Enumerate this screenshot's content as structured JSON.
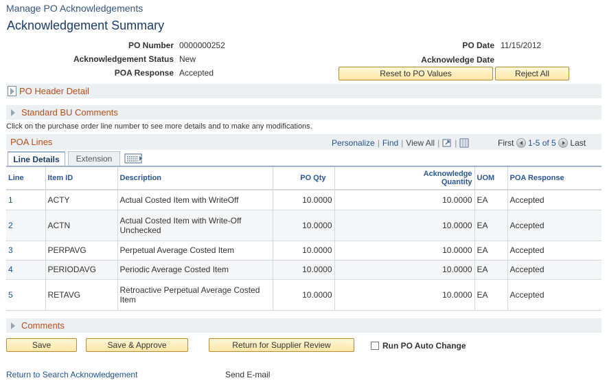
{
  "header": {
    "breadcrumb": "Manage PO Acknowledgements",
    "title": "Acknowledgement Summary"
  },
  "summary": {
    "po_number_label": "PO Number",
    "po_number": "0000000252",
    "ack_status_label": "Acknowledgement Status",
    "ack_status": "New",
    "poa_response_label": "POA Response",
    "poa_response": "Accepted",
    "po_date_label": "PO Date",
    "po_date": "11/15/2012",
    "ack_date_label": "Acknowledge Date",
    "reset_button": "Reset to PO Values",
    "reject_button": "Reject All"
  },
  "sections": {
    "po_header_detail": "PO Header Detail",
    "standard_bu_comments": "Standard BU Comments",
    "comments": "Comments"
  },
  "instruction": "Click on the purchase order line number to see more details and to make any modifications.",
  "grid": {
    "title": "POA Lines",
    "personalize": "Personalize",
    "find": "Find",
    "view_all": "View All",
    "first": "First",
    "range": "1-5 of 5",
    "last": "Last",
    "tabs": {
      "line_details": "Line Details",
      "extension": "Extension"
    },
    "columns": {
      "line": "Line",
      "item_id": "Item ID",
      "description": "Description",
      "po_qty": "PO Qty",
      "ack_qty_1": "Acknowledge",
      "ack_qty_2": "Quantity",
      "uom": "UOM",
      "poa_response": "POA Response"
    },
    "rows": [
      {
        "line": "1",
        "item_id": "ACTY",
        "description": "Actual Costed Item with WriteOff",
        "po_qty": "10.0000",
        "ack_qty": "10.0000",
        "uom": "EA",
        "response": "Accepted"
      },
      {
        "line": "2",
        "item_id": "ACTN",
        "description": "Actual Costed Item with Write-Off Unchecked",
        "po_qty": "10.0000",
        "ack_qty": "10.0000",
        "uom": "EA",
        "response": "Accepted"
      },
      {
        "line": "3",
        "item_id": "PERPAVG",
        "description": "Perpetual Average Costed Item",
        "po_qty": "10.0000",
        "ack_qty": "10.0000",
        "uom": "EA",
        "response": "Accepted"
      },
      {
        "line": "4",
        "item_id": "PERIODAVG",
        "description": "Periodic Average Costed Item",
        "po_qty": "10.0000",
        "ack_qty": "10.0000",
        "uom": "EA",
        "response": "Accepted"
      },
      {
        "line": "5",
        "item_id": "RETAVG",
        "description": "Retroactive Perpetual Average Costed Item",
        "po_qty": "10.0000",
        "ack_qty": "10.0000",
        "uom": "EA",
        "response": "Accepted"
      }
    ]
  },
  "actions": {
    "save": "Save",
    "save_approve": "Save & Approve",
    "return_supplier": "Return for Supplier Review",
    "run_auto_change": "Run PO Auto Change",
    "run_auto_change_checked": false
  },
  "footer": {
    "return_search": "Return to Search Acknowledgement",
    "send_email": "Send E-mail"
  },
  "icons": {
    "zoom": "zoom-grid-icon",
    "download": "download-spreadsheet-icon",
    "show_all_columns": "show-all-columns-icon",
    "prev": "previous-row-icon",
    "next": "next-row-icon",
    "expand": "expand-triangle-icon"
  },
  "colors": {
    "title": "#1b3d6b",
    "link": "#1f5390",
    "section_label": "#b84e1a",
    "button_fill": "#fde7a6"
  }
}
